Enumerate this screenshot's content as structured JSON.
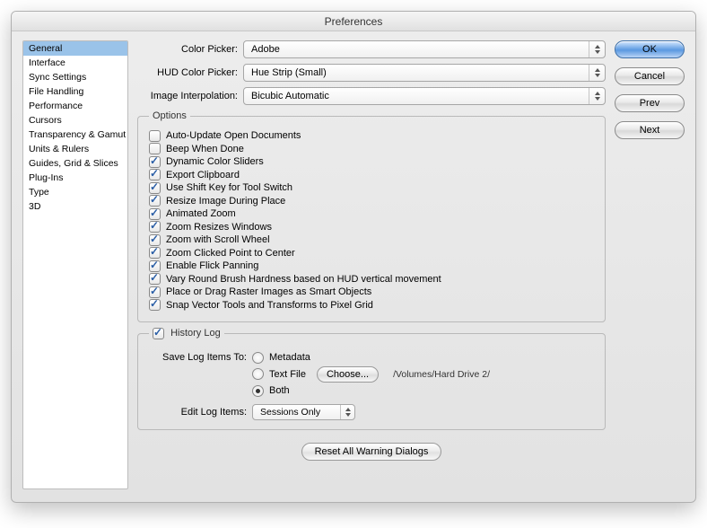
{
  "window": {
    "title": "Preferences"
  },
  "sidebar": {
    "items": [
      "General",
      "Interface",
      "Sync Settings",
      "File Handling",
      "Performance",
      "Cursors",
      "Transparency & Gamut",
      "Units & Rulers",
      "Guides, Grid & Slices",
      "Plug-Ins",
      "Type",
      "3D"
    ],
    "selected": 0
  },
  "buttons": {
    "ok": "OK",
    "cancel": "Cancel",
    "prev": "Prev",
    "next": "Next"
  },
  "pickers": {
    "colorPickerLabel": "Color Picker:",
    "colorPickerValue": "Adobe",
    "hudLabel": "HUD Color Picker:",
    "hudValue": "Hue Strip (Small)",
    "interpLabel": "Image Interpolation:",
    "interpValue": "Bicubic Automatic"
  },
  "optionsLegend": "Options",
  "options": [
    {
      "checked": false,
      "label": "Auto-Update Open Documents"
    },
    {
      "checked": false,
      "label": "Beep When Done"
    },
    {
      "checked": true,
      "label": "Dynamic Color Sliders"
    },
    {
      "checked": true,
      "label": "Export Clipboard"
    },
    {
      "checked": true,
      "label": "Use Shift Key for Tool Switch"
    },
    {
      "checked": true,
      "label": "Resize Image During Place"
    },
    {
      "checked": true,
      "label": "Animated Zoom"
    },
    {
      "checked": true,
      "label": "Zoom Resizes Windows"
    },
    {
      "checked": true,
      "label": "Zoom with Scroll Wheel"
    },
    {
      "checked": true,
      "label": "Zoom Clicked Point to Center"
    },
    {
      "checked": true,
      "label": "Enable Flick Panning"
    },
    {
      "checked": true,
      "label": "Vary Round Brush Hardness based on HUD vertical movement"
    },
    {
      "checked": true,
      "label": "Place or Drag Raster Images as Smart Objects"
    },
    {
      "checked": true,
      "label": "Snap Vector Tools and Transforms to Pixel Grid"
    }
  ],
  "history": {
    "enabled": true,
    "title": "History Log",
    "saveLabel": "Save Log Items To:",
    "radios": {
      "metadata": "Metadata",
      "textfile": "Text File",
      "both": "Both"
    },
    "selected": "both",
    "chooseLabel": "Choose...",
    "path": "/Volumes/Hard Drive 2/",
    "editLabel": "Edit Log Items:",
    "editValue": "Sessions Only"
  },
  "resetLabel": "Reset All Warning Dialogs"
}
